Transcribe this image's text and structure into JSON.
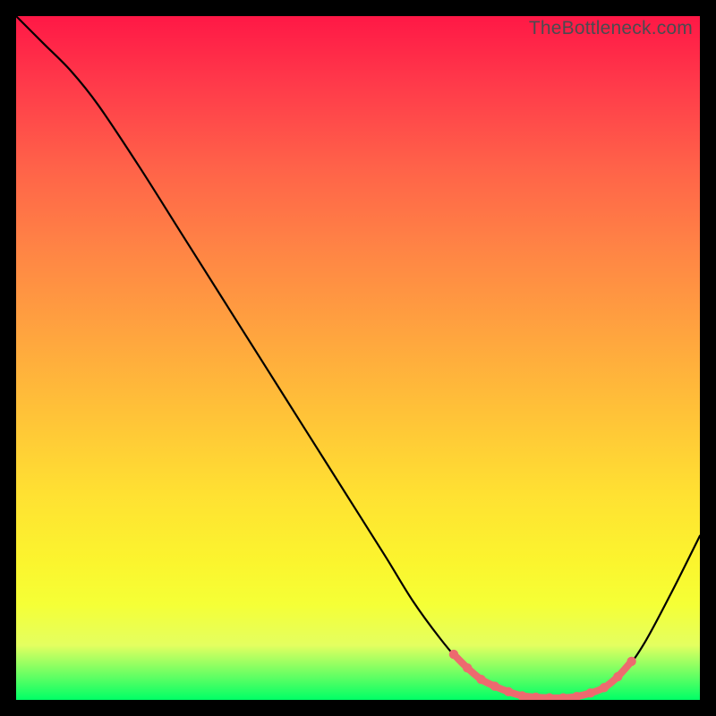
{
  "watermark": "TheBottleneck.com",
  "colors": {
    "curve": "#000000",
    "band": "#ed6a6f"
  },
  "chart_data": {
    "type": "line",
    "title": "",
    "xlabel": "",
    "ylabel": "",
    "xlim": [
      0,
      100
    ],
    "ylim": [
      0,
      100
    ],
    "grid": false,
    "curve_xy": [
      [
        0,
        100
      ],
      [
        4,
        96
      ],
      [
        8,
        92
      ],
      [
        12,
        87
      ],
      [
        18,
        78
      ],
      [
        24,
        68.5
      ],
      [
        30,
        59
      ],
      [
        36,
        49.5
      ],
      [
        42,
        40
      ],
      [
        48,
        30.5
      ],
      [
        54,
        21
      ],
      [
        58,
        14.5
      ],
      [
        62,
        9
      ],
      [
        65,
        5.5
      ],
      [
        68,
        3
      ],
      [
        71,
        1.5
      ],
      [
        74,
        0.6
      ],
      [
        77,
        0.3
      ],
      [
        80,
        0.3
      ],
      [
        83,
        0.6
      ],
      [
        86,
        1.8
      ],
      [
        89,
        4.2
      ],
      [
        92,
        8.5
      ],
      [
        96,
        16
      ],
      [
        100,
        24
      ]
    ],
    "band_x_range": [
      64,
      90
    ],
    "band_dot_step": 2.0
  }
}
